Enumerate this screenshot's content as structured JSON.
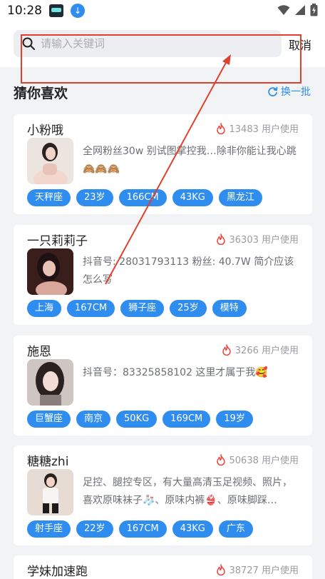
{
  "status_bar": {
    "time": "10:28",
    "icons": [
      "app-icon",
      "download-icon",
      "wifi-icon",
      "signal-icon",
      "battery-icon"
    ]
  },
  "search": {
    "placeholder": "请输入关键词",
    "value": "",
    "cancel_label": "取消"
  },
  "section": {
    "title": "猜你喜欢",
    "refresh_label": "换一批"
  },
  "colors": {
    "accent": "#2f8df0",
    "fire": "#e8453c",
    "annotation": "#e2402f"
  },
  "cards": [
    {
      "name": "小粉哦",
      "usage": "13483 用户使用",
      "desc": "全网粉丝30w 别试图掌控我…除非你能让我心跳🙈🙈🙈",
      "tags": [
        "天秤座",
        "23岁",
        "166CM",
        "43KG",
        "黑龙江"
      ]
    },
    {
      "name": "一只莉莉子",
      "usage": "36303 用户使用",
      "desc": "抖音号: 28031793113 粉丝: 40.7W 简介应该怎么写",
      "tags": [
        "上海",
        "167CM",
        "狮子座",
        "25岁",
        "模特"
      ]
    },
    {
      "name": "施恩",
      "usage": "3266 用户使用",
      "desc": "抖音号：83325858102 这里才属于我🥰",
      "tags": [
        "巨蟹座",
        "南京",
        "50KG",
        "169CM",
        "19岁"
      ]
    },
    {
      "name": "糖糖zhi",
      "usage": "50638 用户使用",
      "desc": "足控、腿控专区，有大量高清玉足视频、照片，喜欢原味袜子🧦、原味内裤👙、原味脚踩…",
      "tags": [
        "射手座",
        "22岁",
        "167CM",
        "43KG",
        "广东"
      ]
    },
    {
      "name": "学妹加速跑",
      "usage": "38727 用户使用",
      "desc": "",
      "tags": []
    }
  ]
}
